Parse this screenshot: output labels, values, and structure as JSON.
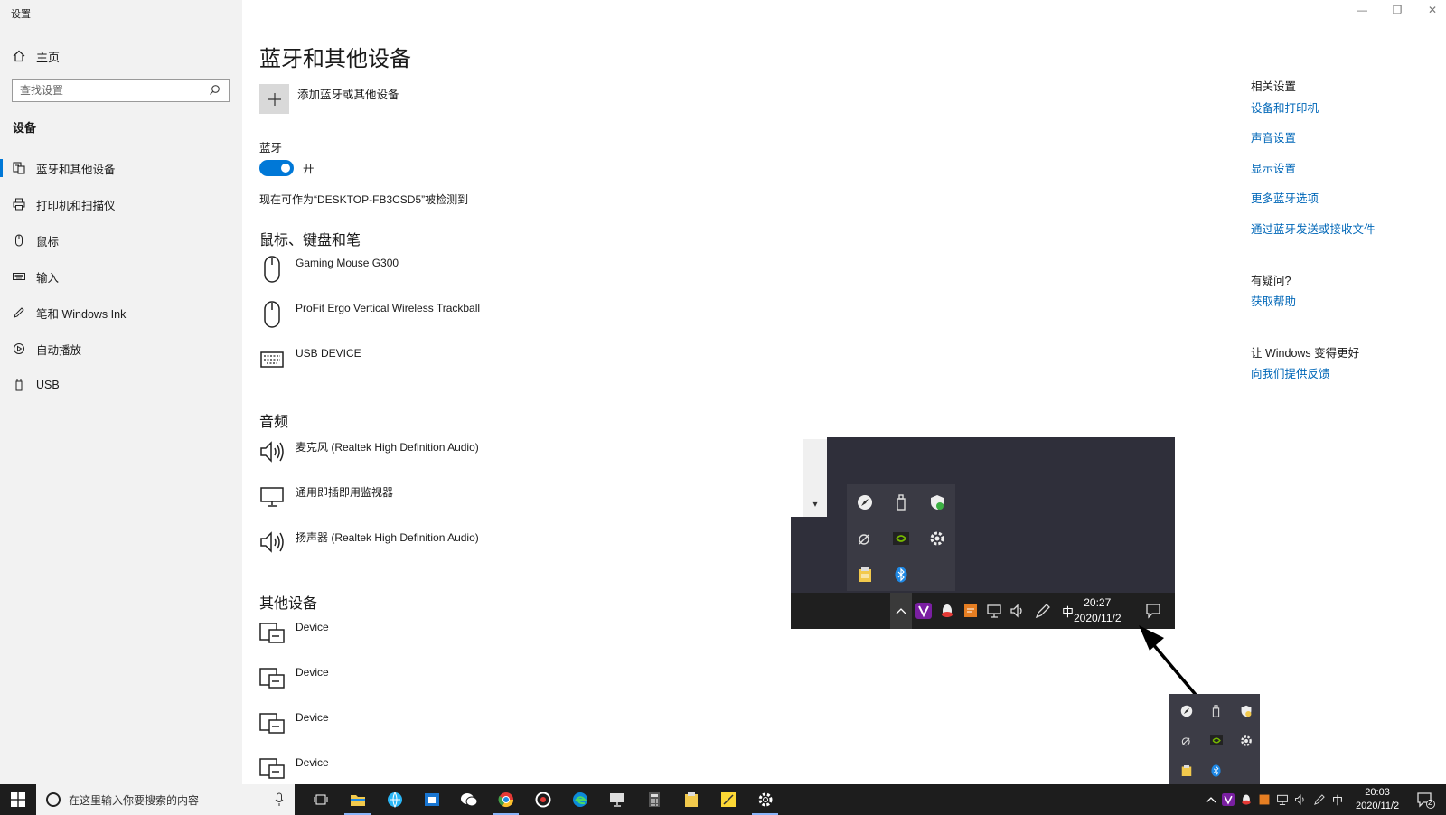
{
  "window": {
    "title": "设置",
    "minimize": "—",
    "restore": "❐",
    "close": "✕"
  },
  "sidebar": {
    "home_label": "主页",
    "search_placeholder": "查找设置",
    "section": "设备",
    "items": [
      {
        "label": "蓝牙和其他设备",
        "icon": "bluetooth-devices-icon",
        "active": true
      },
      {
        "label": "打印机和扫描仪",
        "icon": "printer-icon",
        "active": false
      },
      {
        "label": "鼠标",
        "icon": "mouse-icon",
        "active": false
      },
      {
        "label": "输入",
        "icon": "keyboard-icon",
        "active": false
      },
      {
        "label": "笔和 Windows Ink",
        "icon": "pen-icon",
        "active": false
      },
      {
        "label": "自动播放",
        "icon": "autoplay-icon",
        "active": false
      },
      {
        "label": "USB",
        "icon": "usb-icon",
        "active": false
      }
    ]
  },
  "main": {
    "title": "蓝牙和其他设备",
    "add_device": "添加蓝牙或其他设备",
    "bluetooth_label": "蓝牙",
    "bluetooth_state": "开",
    "discoverable": "现在可作为“DESKTOP-FB3CSD5”被检测到",
    "sections": [
      {
        "title": "鼠标、键盘和笔",
        "devices": [
          {
            "name": "Gaming Mouse G300",
            "icon": "mouse-icon"
          },
          {
            "name": "ProFit Ergo Vertical Wireless Trackball",
            "icon": "mouse-icon"
          },
          {
            "name": "USB DEVICE",
            "icon": "keyboard-icon"
          }
        ]
      },
      {
        "title": "音频",
        "devices": [
          {
            "name": "麦克风 (Realtek High Definition Audio)",
            "icon": "speaker-icon"
          },
          {
            "name": "通用即插即用监视器",
            "icon": "monitor-icon"
          },
          {
            "name": "扬声器 (Realtek High Definition Audio)",
            "icon": "speaker-icon"
          }
        ]
      },
      {
        "title": "其他设备",
        "devices": [
          {
            "name": "Device",
            "icon": "generic-device-icon"
          },
          {
            "name": "Device",
            "icon": "generic-device-icon"
          },
          {
            "name": "Device",
            "icon": "generic-device-icon"
          },
          {
            "name": "Device",
            "icon": "generic-device-icon"
          }
        ]
      }
    ]
  },
  "related": {
    "heading": "相关设置",
    "links": [
      "设备和打印机",
      "声音设置",
      "显示设置",
      "更多蓝牙选项",
      "通过蓝牙发送或接收文件"
    ],
    "question_heading": "有疑问?",
    "help_link": "获取帮助",
    "improve_heading": "让 Windows 变得更好",
    "feedback_link": "向我们提供反馈"
  },
  "inset": {
    "time": "20:27",
    "date": "2020/11/2",
    "ime": "中"
  },
  "taskbar": {
    "search_placeholder": "在这里输入你要搜索的内容",
    "time": "20:03",
    "date": "2020/11/2",
    "ime": "中",
    "notif_count": "2"
  },
  "colors": {
    "accent": "#0078d7",
    "link": "#0067b8",
    "sidebar_bg": "#f2f2f2",
    "taskbar_bg": "#1d1d1d"
  }
}
